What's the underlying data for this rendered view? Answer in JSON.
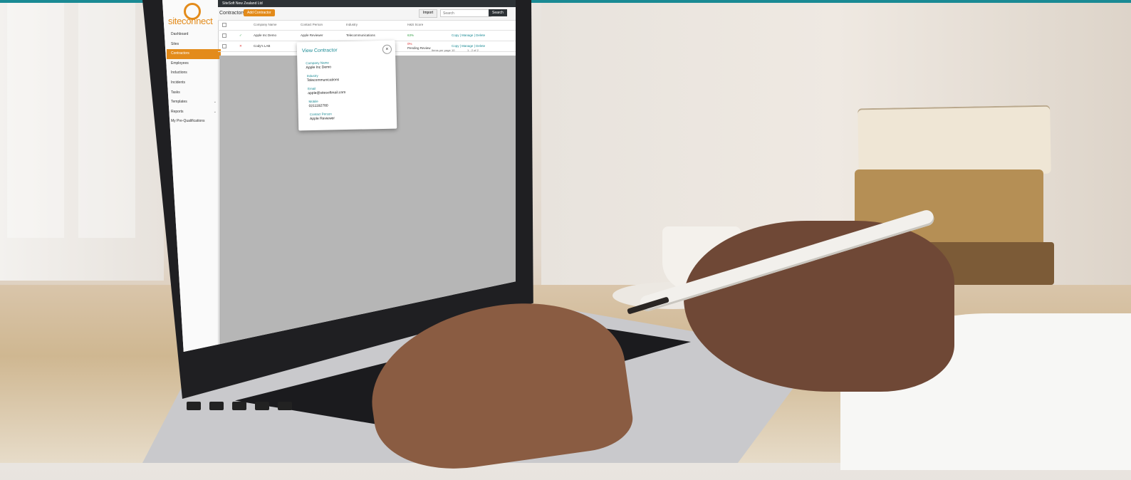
{
  "app": {
    "org_selector": "SiteSoft New Zealand Ltd",
    "logo_text": "siteconnect",
    "page_title": "Contractors",
    "add_button": "Add Contractor",
    "import_button": "Import",
    "search_placeholder": "Search",
    "search_button": "Search"
  },
  "sidebar": {
    "items": [
      {
        "label": "Dashboard"
      },
      {
        "label": "Sites"
      },
      {
        "label": "Contractors",
        "active": true
      },
      {
        "label": "Employees"
      },
      {
        "label": "Inductions"
      },
      {
        "label": "Incidents"
      },
      {
        "label": "Tasks"
      },
      {
        "label": "Templates",
        "has_chevron": true
      },
      {
        "label": "Reports",
        "has_chevron": true
      },
      {
        "label": "My Pre-Qualifications"
      }
    ]
  },
  "table": {
    "columns": [
      "Company Name",
      "Contact Person",
      "Industry",
      "H&S Score"
    ],
    "rows": [
      {
        "status_icon": "check-icon",
        "company": "Apple Inc Demo",
        "contact": "Apple Reviewer",
        "industry": "Telecommunications",
        "score": "63%",
        "score_status": "",
        "action": "Copy | Manage | Delete"
      },
      {
        "status_icon": "cross-icon",
        "company": "Cody's LAB",
        "contact": "",
        "industry": "",
        "score": "0%",
        "score_status": "Pending Review",
        "action": "Copy | Manage | Delete"
      }
    ],
    "pager": {
      "items_per_page_label": "Items per page",
      "items_per_page": "10",
      "range": "1 - 2 of 2"
    }
  },
  "modal": {
    "title": "View Contractor",
    "close_label": "×",
    "fields": [
      {
        "label": "Company Name",
        "value": "Apple Inc Demo"
      },
      {
        "label": "Industry",
        "value": "Telecommunications"
      },
      {
        "label": "Email",
        "value": "apple@sitesoftmail.com"
      },
      {
        "label": "Mobile",
        "value": "0211182780"
      },
      {
        "label": "Contact Person",
        "value": "Apple Reviewer"
      }
    ]
  },
  "colors": {
    "accent": "#e38b1b",
    "teal": "#1a8a94",
    "topbar": "#2d3236"
  }
}
